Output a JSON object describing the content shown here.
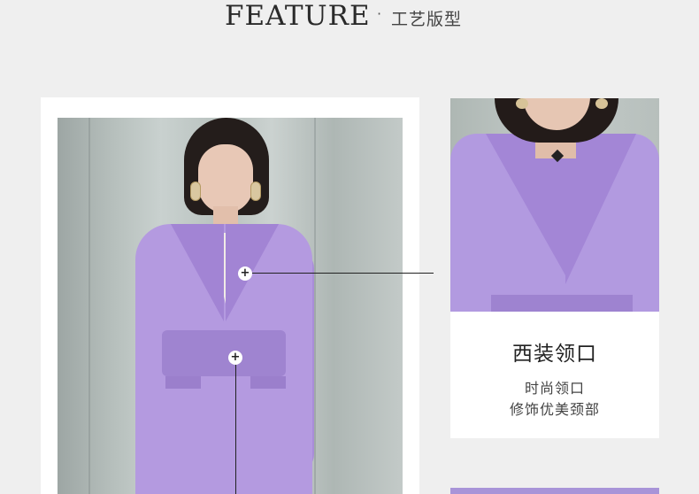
{
  "header": {
    "title": "FEATURE",
    "separator": "·",
    "subtitle": "工艺版型"
  },
  "hotspots": {
    "collar_symbol": "+",
    "waist_symbol": "+"
  },
  "caption": {
    "title": "西装领口",
    "line1": "时尚领口",
    "line2": "修饰优美颈部"
  },
  "colors": {
    "background": "#efefef",
    "jacket_lavender": "#b49ae0",
    "frame_white": "#ffffff",
    "callout_line": "#222222"
  }
}
